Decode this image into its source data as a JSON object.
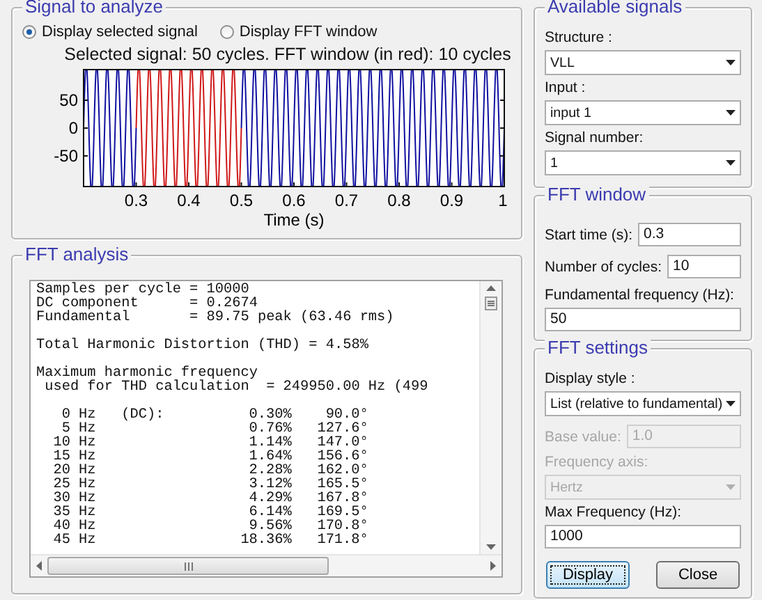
{
  "signal_panel": {
    "title": "Signal to analyze",
    "options": [
      {
        "label": "Display selected signal",
        "selected": true
      },
      {
        "label": "Display FFT window",
        "selected": false
      }
    ],
    "plot": {
      "title": "Selected signal: 50 cycles. FFT window (in red): 10 cycles",
      "yticks": [
        "50",
        "0",
        "-50"
      ],
      "xticks": [
        "0.3",
        "0.4",
        "0.5",
        "0.6",
        "0.7",
        "0.8",
        "0.9",
        "1"
      ],
      "xlabel": "Time (s)"
    }
  },
  "analysis_panel": {
    "title": "FFT analysis",
    "lines": [
      {
        "kind": "text",
        "text": "Samples per cycle = 10000"
      },
      {
        "kind": "text",
        "text": "DC component      = 0.2674"
      },
      {
        "kind": "text",
        "text": "Fundamental       = 89.75 peak (63.46 rms)"
      },
      {
        "kind": "blank"
      },
      {
        "kind": "text",
        "text": "Total Harmonic Distortion (THD) = 4.58%"
      },
      {
        "kind": "blank"
      },
      {
        "kind": "text",
        "text": "Maximum harmonic frequency"
      },
      {
        "kind": "text",
        "text": " used for THD calculation  = 249950.00 Hz (499"
      },
      {
        "kind": "blank"
      }
    ],
    "harmonics": [
      {
        "freq": "0 Hz",
        "note": "(DC):",
        "magnitude": "0.30%",
        "phase": "90.0°"
      },
      {
        "freq": "5 Hz",
        "magnitude": "0.76%",
        "phase": "127.6°"
      },
      {
        "freq": "10 Hz",
        "magnitude": "1.14%",
        "phase": "147.0°"
      },
      {
        "freq": "15 Hz",
        "magnitude": "1.64%",
        "phase": "156.6°"
      },
      {
        "freq": "20 Hz",
        "magnitude": "2.28%",
        "phase": "162.0°"
      },
      {
        "freq": "25 Hz",
        "magnitude": "3.12%",
        "phase": "165.5°"
      },
      {
        "freq": "30 Hz",
        "magnitude": "4.29%",
        "phase": "167.8°"
      },
      {
        "freq": "35 Hz",
        "magnitude": "6.14%",
        "phase": "169.5°"
      },
      {
        "freq": "40 Hz",
        "magnitude": "9.56%",
        "phase": "170.8°"
      },
      {
        "freq": "45 Hz",
        "magnitude": "18.36%",
        "phase": "171.8°"
      }
    ]
  },
  "available_signals": {
    "title": "Available signals",
    "fields": [
      {
        "kind": "dropdown",
        "label": "Structure :",
        "value": "VLL",
        "disabled": false
      },
      {
        "kind": "dropdown",
        "label": "Input :",
        "value": "input 1",
        "disabled": false
      },
      {
        "kind": "dropdown",
        "label": "Signal number:",
        "value": "1",
        "disabled": false
      }
    ]
  },
  "fft_window": {
    "title": "FFT window",
    "fields": [
      {
        "kind": "inline",
        "label": "Start time (s):",
        "value": "0.3",
        "disabled": false
      },
      {
        "kind": "inline",
        "label": "Number of cycles:",
        "value": "10",
        "disabled": false
      },
      {
        "kind": "stacked",
        "label": "Fundamental frequency (Hz):",
        "value": "50",
        "disabled": false
      }
    ]
  },
  "fft_settings": {
    "title": "FFT settings",
    "fields": [
      {
        "kind": "dropdown",
        "label": "Display style :",
        "value": "List (relative to fundamental)",
        "disabled": false
      },
      {
        "kind": "inline",
        "label": "Base value:",
        "value": "1.0",
        "disabled": true
      },
      {
        "kind": "dropdown",
        "label": "Frequency axis:",
        "value": "Hertz",
        "disabled": true
      },
      {
        "kind": "stacked",
        "label": "Max Frequency (Hz):",
        "value": "1000",
        "disabled": false
      }
    ],
    "buttons": [
      {
        "label": "Display",
        "focused": true
      },
      {
        "label": "Close",
        "focused": false
      }
    ]
  }
}
